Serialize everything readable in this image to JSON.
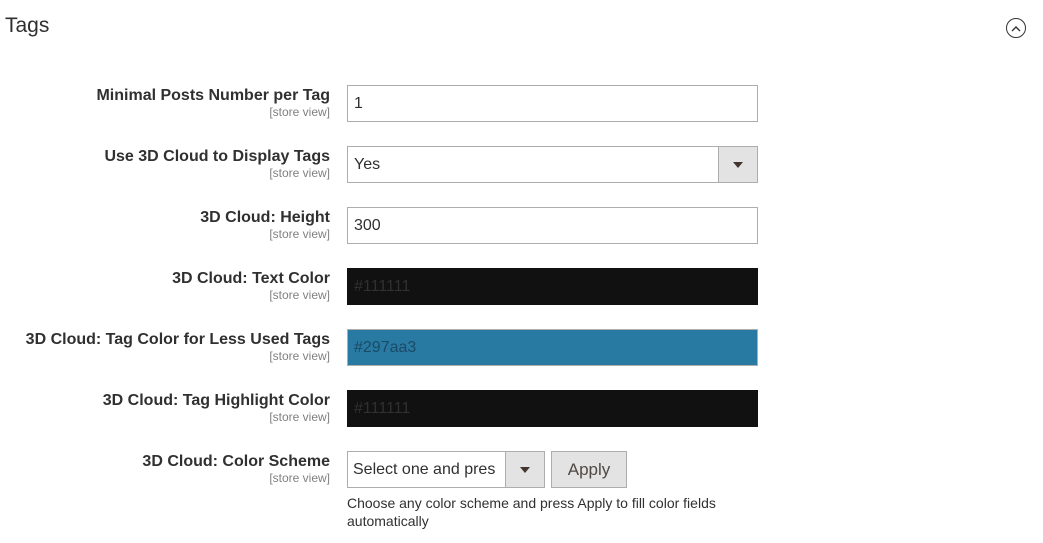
{
  "section": {
    "title": "Tags",
    "collapse_icon": "chevron-up-circle-icon"
  },
  "fields": {
    "min_posts": {
      "label": "Minimal Posts Number per Tag",
      "scope": "[store view]",
      "value": "1"
    },
    "use_3d_cloud": {
      "label": "Use 3D Cloud to Display Tags",
      "scope": "[store view]",
      "value": "Yes"
    },
    "cloud_height": {
      "label": "3D Cloud: Height",
      "scope": "[store view]",
      "value": "300"
    },
    "text_color": {
      "label": "3D Cloud: Text Color",
      "scope": "[store view]",
      "value": "#111111",
      "color": "#111111"
    },
    "less_used_color": {
      "label": "3D Cloud: Tag Color for Less Used Tags",
      "scope": "[store view]",
      "value": "#297aa3",
      "color": "#297aa3"
    },
    "highlight_color": {
      "label": "3D Cloud: Tag Highlight Color",
      "scope": "[store view]",
      "value": "#111111",
      "color": "#111111"
    },
    "color_scheme": {
      "label": "3D Cloud: Color Scheme",
      "scope": "[store view]",
      "value": "Select one and press",
      "apply_label": "Apply",
      "note": "Choose any color scheme and press Apply to fill color fields automatically"
    }
  }
}
